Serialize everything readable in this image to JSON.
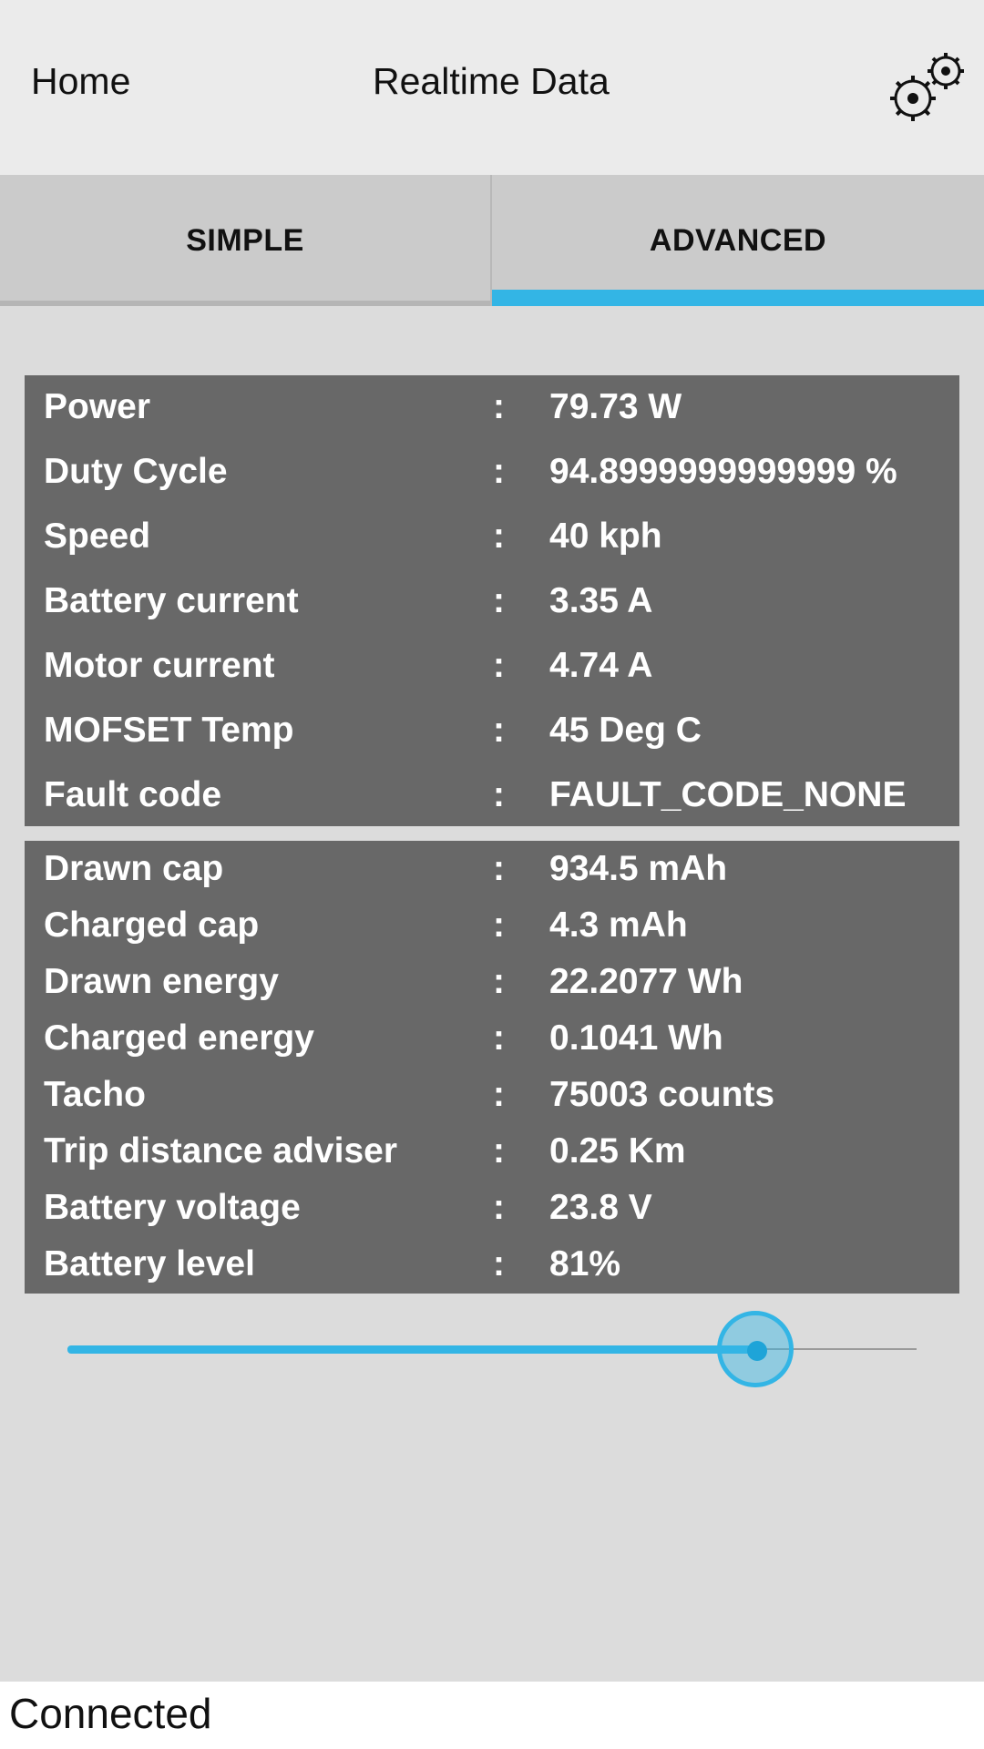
{
  "header": {
    "home_label": "Home",
    "title": "Realtime Data",
    "settings_icon": "gears-icon"
  },
  "tabs": [
    {
      "label": "SIMPLE",
      "active": false
    },
    {
      "label": "ADVANCED",
      "active": true
    }
  ],
  "realtime": [
    {
      "label": "Power",
      "value": "79.73 W"
    },
    {
      "label": "Duty Cycle",
      "value": "94.8999999999999 %"
    },
    {
      "label": "Speed",
      "value": "40 kph"
    },
    {
      "label": "Battery current",
      "value": "3.35 A"
    },
    {
      "label": "Motor current",
      "value": "4.74 A"
    },
    {
      "label": "MOFSET Temp",
      "value": "45 Deg C"
    },
    {
      "label": "Fault code",
      "value": "FAULT_CODE_NONE"
    }
  ],
  "stats": [
    {
      "label": "Drawn cap",
      "value": "934.5 mAh"
    },
    {
      "label": "Charged cap",
      "value": "4.3 mAh"
    },
    {
      "label": "Drawn energy",
      "value": "22.2077 Wh"
    },
    {
      "label": "Charged energy",
      "value": "0.1041 Wh"
    },
    {
      "label": "Tacho",
      "value": "75003 counts"
    },
    {
      "label": "Trip distance adviser",
      "value": "0.25 Km"
    },
    {
      "label": "Battery voltage",
      "value": "23.8 V"
    },
    {
      "label": "Battery level",
      "value": "81%"
    }
  ],
  "separator": ":",
  "slider": {
    "value_fraction": 0.81
  },
  "status": {
    "text": "Connected"
  },
  "colors": {
    "accent": "#33b5e5",
    "panel": "#686868",
    "background": "#dcdcdc"
  }
}
